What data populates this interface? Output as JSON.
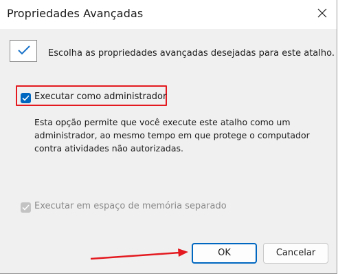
{
  "dialog": {
    "title": "Propriedades Avançadas",
    "close_icon": "close-icon",
    "header_text": "Escolha as propriedades avançadas desejadas para este atalho."
  },
  "options": {
    "run_as_admin": {
      "label": "Executar como administrador",
      "checked": true
    },
    "description": [
      "Esta opção permite que você execute este atalho como um",
      "administrador, ao mesmo tempo em que protege o computador",
      "contra atividades não autorizadas."
    ],
    "separate_memory": {
      "label": "Executar em espaço de memória separado",
      "checked": true,
      "disabled": true
    }
  },
  "buttons": {
    "ok_label": "OK",
    "cancel_label": "Cancelar"
  },
  "colors": {
    "accent": "#0067c0",
    "annotation": "#e3191f"
  }
}
